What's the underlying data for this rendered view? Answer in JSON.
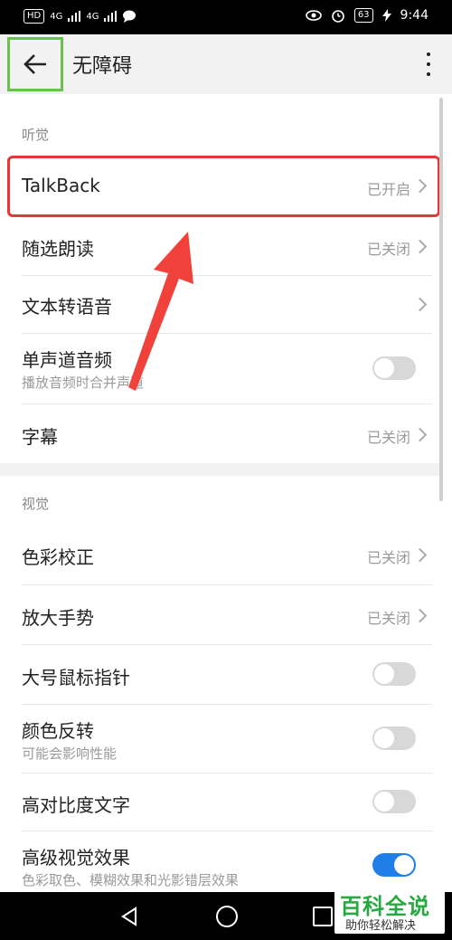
{
  "status_bar": {
    "left_badge": "HD",
    "signal1": "4G",
    "signal2": "4G",
    "battery": "63",
    "time": "9:44"
  },
  "app_bar": {
    "title": "无障碍"
  },
  "sections": {
    "hearing": {
      "label": "听觉",
      "items": [
        {
          "title": "TalkBack",
          "status": "已开启"
        },
        {
          "title": "随选朗读",
          "status": "已关闭"
        },
        {
          "title": "文本转语音",
          "status": ""
        },
        {
          "title": "单声道音频",
          "subtitle": "播放音频时合并声道",
          "toggle": "off"
        },
        {
          "title": "字幕",
          "status": "已关闭"
        }
      ]
    },
    "vision": {
      "label": "视觉",
      "items": [
        {
          "title": "色彩校正",
          "status": "已关闭"
        },
        {
          "title": "放大手势",
          "status": "已关闭"
        },
        {
          "title": "大号鼠标指针",
          "toggle": "off"
        },
        {
          "title": "颜色反转",
          "subtitle": "可能会影响性能",
          "toggle": "off"
        },
        {
          "title": "高对比度文字",
          "toggle": "off"
        },
        {
          "title": "高级视觉效果",
          "subtitle": "色彩取色、模糊效果和光影错层效果",
          "toggle": "on"
        }
      ]
    }
  },
  "watermark": {
    "main": "百科全说",
    "sub": "助你轻松解决"
  },
  "colors": {
    "accent": "#1f7ee8",
    "highlight": "#e53935",
    "back_highlight": "#6bc24a",
    "watermark": "#27a942"
  },
  "icons": [
    "back-arrow-icon",
    "more-vert-icon",
    "chevron-right-icon",
    "nav-back-icon",
    "nav-home-icon",
    "nav-recent-icon",
    "eye-icon",
    "alarm-icon"
  ]
}
